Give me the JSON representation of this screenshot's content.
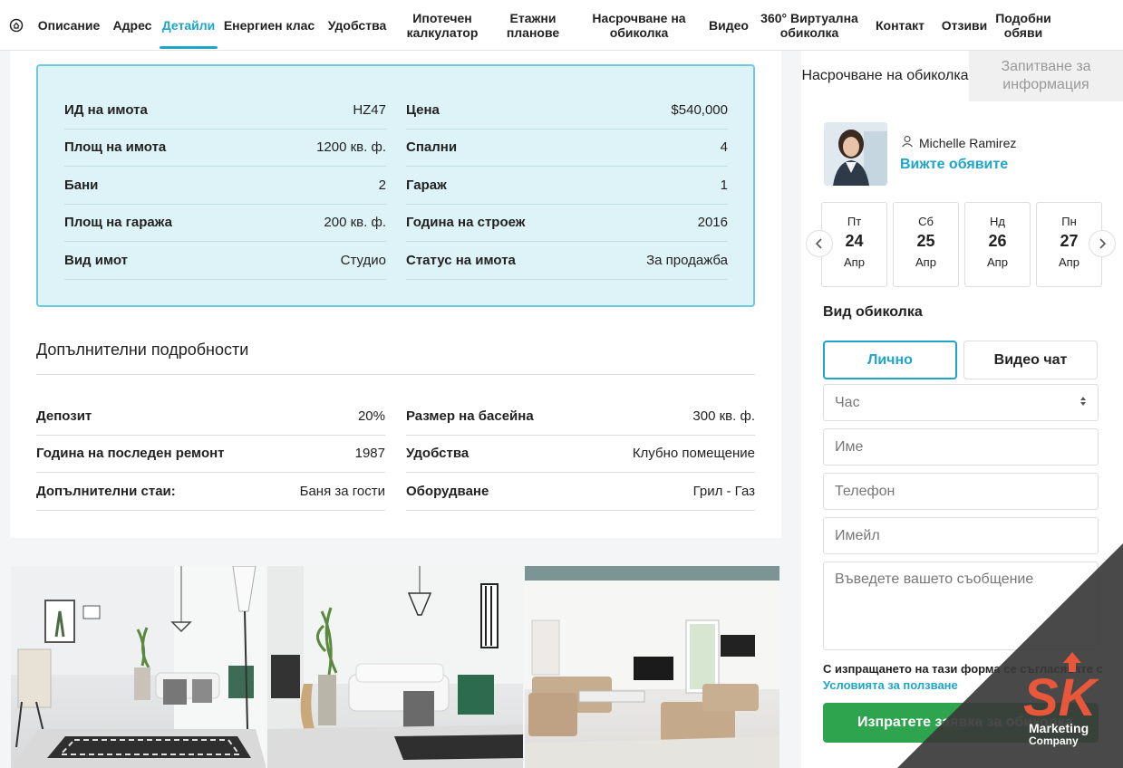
{
  "nav": {
    "items": [
      {
        "label": "Описание",
        "width": 80
      },
      {
        "label": "Адрес",
        "width": 60
      },
      {
        "label": "Детайли",
        "width": 64
      },
      {
        "label": "Енергиен клас",
        "width": 114
      },
      {
        "label": "Удобства",
        "width": 80
      },
      {
        "label": "Ипотечен калкулатор",
        "width": 108
      },
      {
        "label": "Етажни планове",
        "width": 92
      },
      {
        "label": "Насрочване на обиколка",
        "width": 142
      },
      {
        "label": "Видео",
        "width": 56
      },
      {
        "label": "360° Виртуална обиколка",
        "width": 122
      },
      {
        "label": "Контакт",
        "width": 78
      },
      {
        "label": "Отзиви",
        "width": 64
      },
      {
        "label": "Подобни обяви",
        "width": 66
      }
    ],
    "active_index": 2
  },
  "details": {
    "left": [
      {
        "key": "ИД на имота",
        "value": "HZ47"
      },
      {
        "key": "Площ на имота",
        "value": "1200 кв. ф."
      },
      {
        "key": "Бани",
        "value": "2"
      },
      {
        "key": "Площ на гаража",
        "value": "200 кв. ф."
      },
      {
        "key": "Вид имот",
        "value": "Студио"
      }
    ],
    "right": [
      {
        "key": "Цена",
        "value": "$540,000"
      },
      {
        "key": "Спални",
        "value": "4"
      },
      {
        "key": "Гараж",
        "value": "1"
      },
      {
        "key": "Година на строеж",
        "value": "2016"
      },
      {
        "key": "Статус на имота",
        "value": "За продажба"
      }
    ]
  },
  "additional": {
    "title": "Допълнителни подробности",
    "left": [
      {
        "key": "Депозит",
        "value": "20%"
      },
      {
        "key": "Година на последен ремонт",
        "value": "1987"
      },
      {
        "key": "Допълнителни стаи:",
        "value": "Баня за гости"
      }
    ],
    "right": [
      {
        "key": "Размер на басейна",
        "value": "300 кв. ф."
      },
      {
        "key": "Удобства",
        "value": "Клубно помещение"
      },
      {
        "key": "Оборудване",
        "value": "Грил - Газ"
      }
    ]
  },
  "sidebar": {
    "tabs": [
      "Насрочване на обиколка",
      "Запитване за информация"
    ],
    "agent_name": "Michelle Ramirez",
    "agent_link": "Вижте обявите",
    "dates": [
      {
        "dow": "Пт",
        "day": "24",
        "month": "Апр"
      },
      {
        "dow": "Сб",
        "day": "25",
        "month": "Апр"
      },
      {
        "dow": "Нд",
        "day": "26",
        "month": "Апр"
      },
      {
        "dow": "Пн",
        "day": "27",
        "month": "Апр"
      }
    ],
    "tour_label": "Вид обиколка",
    "tour_types": [
      "Лично",
      "Видео чат"
    ],
    "time_placeholder": "Час",
    "name_placeholder": "Име",
    "phone_placeholder": "Телефон",
    "email_placeholder": "Имейл",
    "message_placeholder": "Въведете вашето съобщение",
    "consent_text": "С изпращането на тази форма се съгласявате с",
    "consent_link": "Условията за ползване",
    "submit_label": "Изпратете заявка за обиколка"
  },
  "watermark": {
    "letters": "SK",
    "line1": "Marketing",
    "line2": "Company"
  },
  "colors": {
    "accent": "#1fa5c8",
    "detail_bg": "#def3f8",
    "submit": "#2ea44f"
  }
}
